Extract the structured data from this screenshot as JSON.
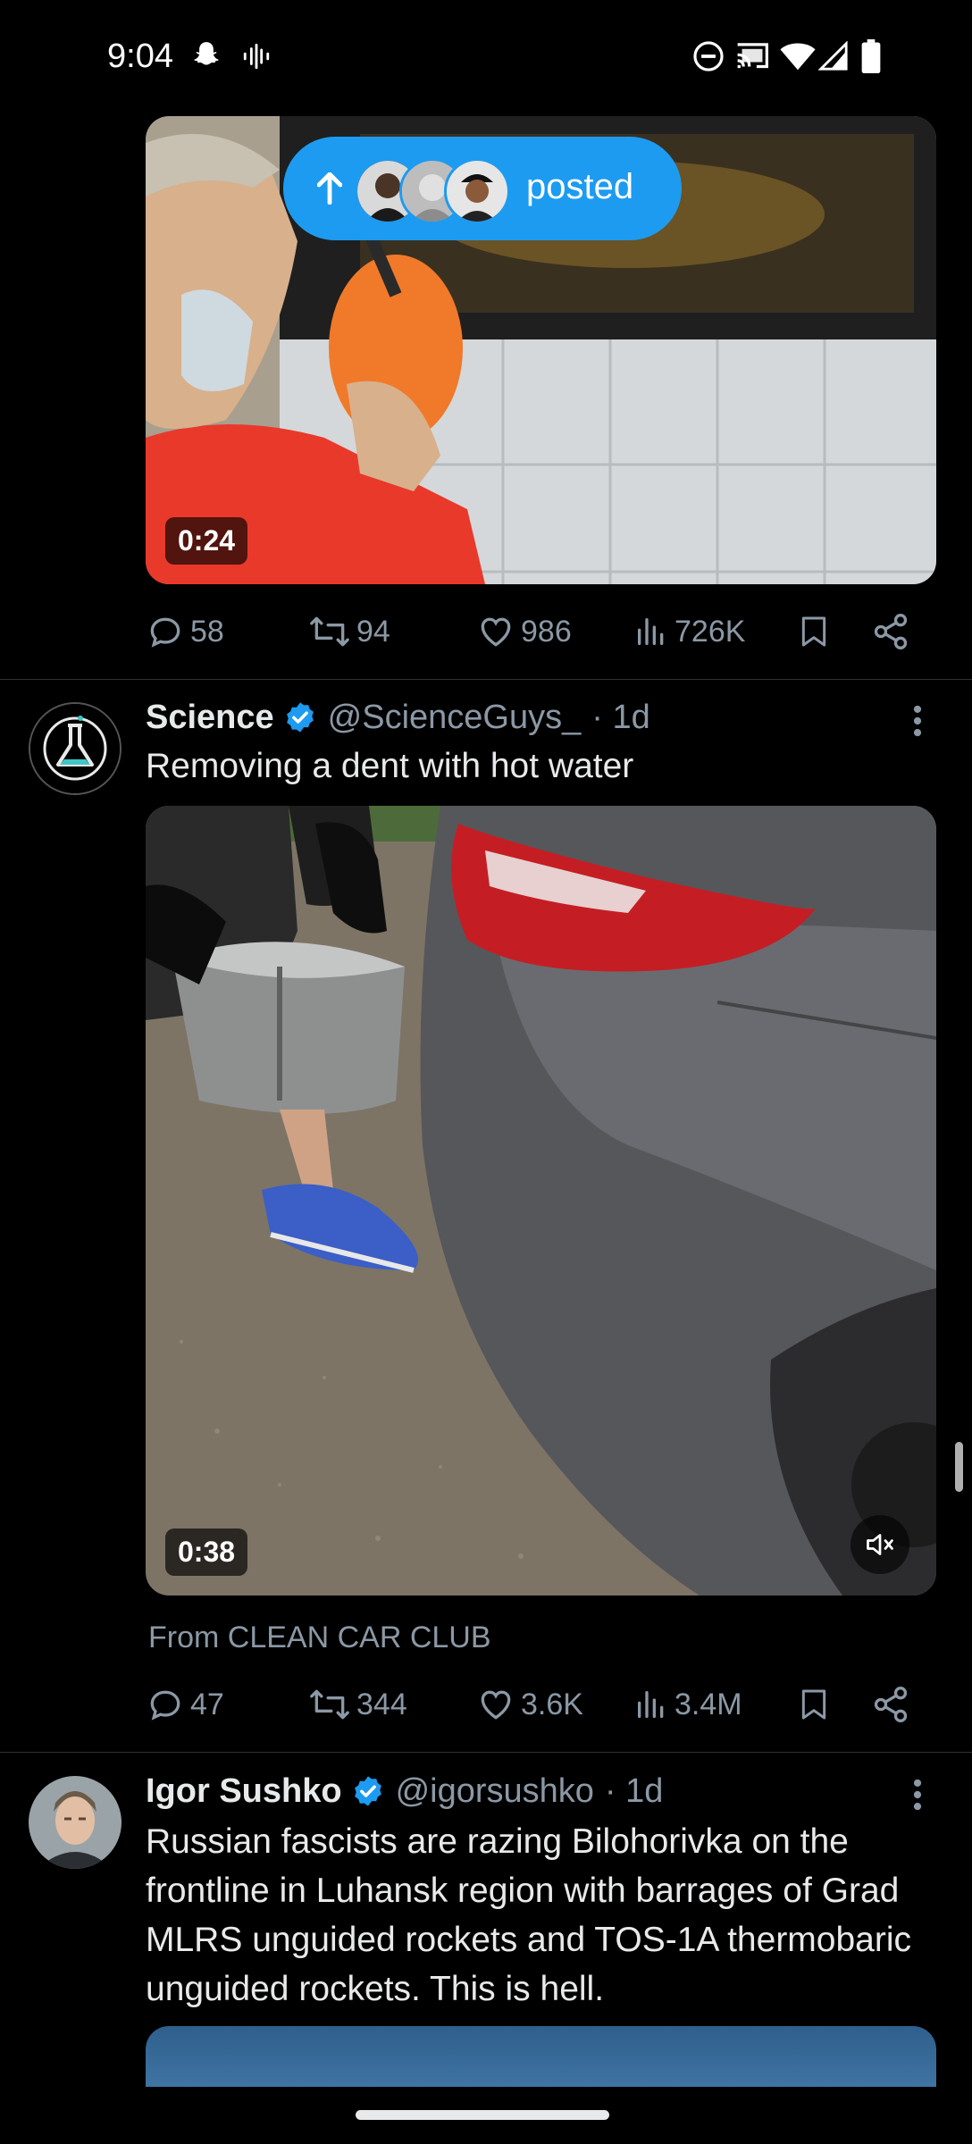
{
  "status_bar": {
    "time": "9:04"
  },
  "posted_pill": {
    "label": "posted"
  },
  "tweet1": {
    "duration": "0:24",
    "replies": "58",
    "reposts": "94",
    "likes": "986",
    "views": "726K"
  },
  "tweet2": {
    "name": "Science",
    "handle": "@ScienceGuys_",
    "time": "· 1d",
    "text": "Removing a dent with hot water",
    "duration": "0:38",
    "source": "From CLEAN CAR CLUB",
    "replies": "47",
    "reposts": "344",
    "likes": "3.6K",
    "views": "3.4M"
  },
  "tweet3": {
    "name": "Igor Sushko",
    "handle": "@igorsushko",
    "time": "· 1d",
    "text": "Russian fascists are razing Bilohorivka on the frontline in Luhansk region with barrages of Grad MLRS unguided rockets and TOS-1A thermobaric unguided rockets. This is hell."
  },
  "colors": {
    "accent": "#1d9bf0",
    "background": "#000000",
    "muted": "#8b98a5"
  }
}
